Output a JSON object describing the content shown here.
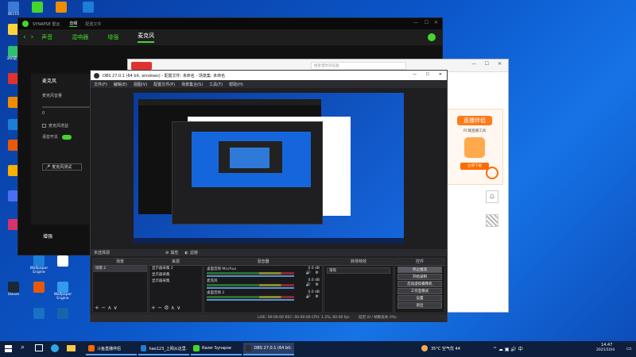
{
  "desktop": {
    "icons_left": [
      {
        "label": "Win10",
        "color": "#3a7bd5"
      },
      {
        "label": "",
        "color": "#ffd43b"
      },
      {
        "label": "360软件",
        "color": "#2fbf71"
      },
      {
        "label": "",
        "color": "#e03131"
      },
      {
        "label": "",
        "color": "#f08c00"
      },
      {
        "label": "",
        "color": "#1c7ed6"
      },
      {
        "label": "",
        "color": "#e8590c"
      },
      {
        "label": "",
        "color": "#fab005"
      },
      {
        "label": "",
        "color": "#4c6ef5"
      },
      {
        "label": "",
        "color": "#d6336c"
      }
    ],
    "icons_bottom": [
      {
        "label": "Steam",
        "color": "#1b2838"
      },
      {
        "label": "Wallpaper Engine",
        "color": "#1c7ed6"
      },
      {
        "label": "",
        "color": "#fff"
      },
      {
        "label": "Wallpaper Engine",
        "color": "#339af0"
      },
      {
        "label": "",
        "color": "#e8590c"
      },
      {
        "label": "",
        "color": "#1971c2"
      },
      {
        "label": "",
        "color": "#1864ab"
      }
    ]
  },
  "synapse": {
    "brand": "SYNAPSE 雷云",
    "top_tabs": [
      "音频",
      "配置文件"
    ],
    "nav_tabs": [
      "声音",
      "混响器",
      "增强",
      "麦克风"
    ],
    "active_tab": "麦克风",
    "section_mic": "麦克风",
    "mic_volume_label": "麦克风音量",
    "mic_volume_value": "0",
    "mic_boost_label": "麦克风增益",
    "voice_switch_label": "语音开关",
    "mic_test_button": "麦克风测试",
    "section_enhance": "增强",
    "accent": "#44d62c"
  },
  "browser": {
    "address": "",
    "search_placeholder": "搜索猎豹浏览器",
    "promo_title": "直播伴侣",
    "promo_sub": "PC端直播工具",
    "download_label": "立即下载"
  },
  "obs": {
    "title": "OBS 27.0.1 (64 bit, windows) - 配置文件: 未命名 - 场景集: 未命名",
    "menu": [
      "文件(F)",
      "编辑(E)",
      "视图(V)",
      "配置文件(P)",
      "场景集合(S)",
      "工具(T)",
      "帮助(H)"
    ],
    "no_source": "未选择源",
    "props_button": "属性",
    "filters_button": "滤镜",
    "docks": {
      "scenes": "场景",
      "sources": "来源",
      "mixer": "混音器",
      "transitions": "转场特效",
      "controls": "控件"
    },
    "scenes_list": [
      "场景 2"
    ],
    "sources_list": [
      "显示器采集 2",
      "显示器采集",
      "显示器采集"
    ],
    "mixer_channels": [
      {
        "name": "桌面音频 Mic/Aux",
        "db": "0.0 dB"
      },
      {
        "name": "麦克风",
        "db": "0.0 dB"
      },
      {
        "name": "桌面音频 2",
        "db": "0.0 dB"
      }
    ],
    "transition_value": "渐隐",
    "transition_duration": "时长",
    "controls_buttons": [
      "停止推流",
      "开始录制",
      "启动虚拟摄像机",
      "工作室模式",
      "设置",
      "退出"
    ],
    "status": "LIVE: 00:00:00   REC: 00:00:00   CPU: 1.2%, 60.00 fps",
    "status_right": "延迟 (0 / 帧数丢失 0%)"
  },
  "taskbar": {
    "apps": [
      {
        "label": "斗鱼直播伴侣",
        "color": "#ff6600"
      },
      {
        "label": "hao123_上网从这里...",
        "color": "#1c7ed6"
      },
      {
        "label": "Razer Synapse",
        "color": "#44d62c"
      },
      {
        "label": "OBS 27.0.1 (64 bit...",
        "color": "#302e31"
      }
    ],
    "weather": "35°C 空气优 44",
    "time": "14:47",
    "date": "2021/10/4"
  }
}
